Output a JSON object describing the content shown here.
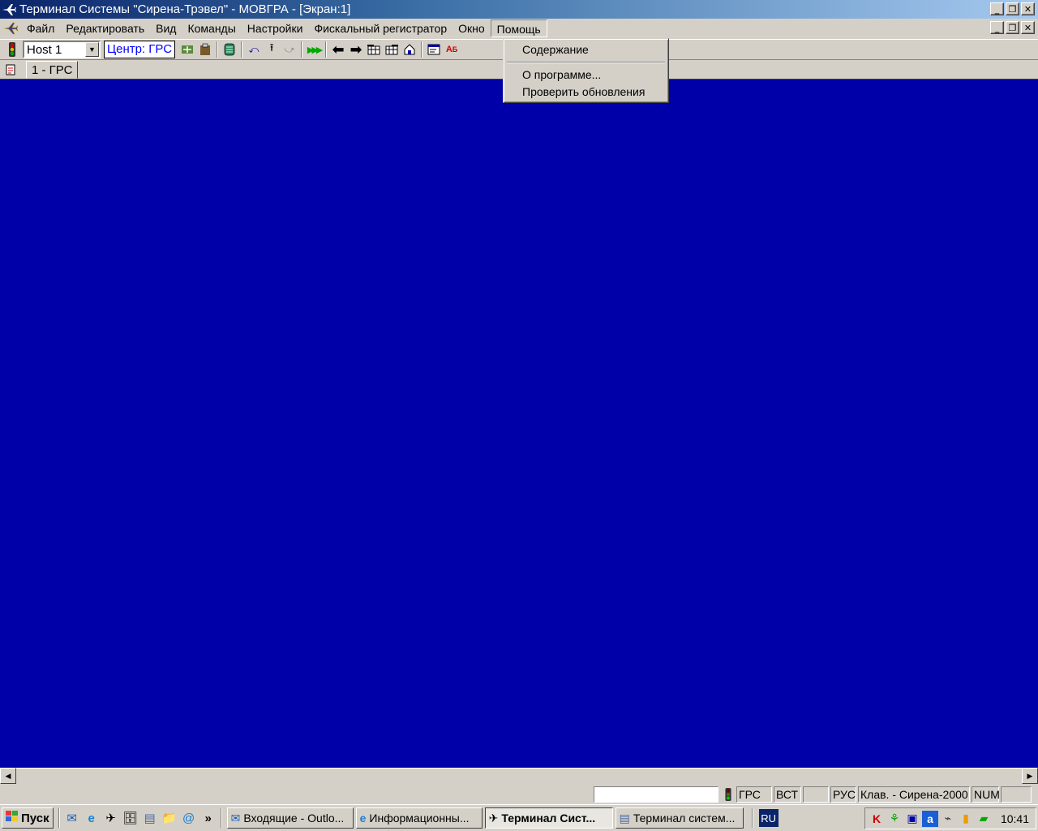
{
  "window": {
    "title": "Терминал Системы \"Сирена-Трэвел\" - МОВГРА - [Экран:1]",
    "app_icon": "airplane-icon"
  },
  "menubar": {
    "items": [
      "Файл",
      "Редактировать",
      "Вид",
      "Команды",
      "Настройки",
      "Фискальный регистратор",
      "Окно",
      "Помощь"
    ],
    "active": "Помощь"
  },
  "help_menu": {
    "items": [
      "Содержание",
      "О программе...",
      "Проверить обновления"
    ]
  },
  "toolbar": {
    "host_select": "Host 1",
    "center_label": "Центр: ГРС"
  },
  "tabs": {
    "screen_tab": "1 - ГРС"
  },
  "terminal": {
    "background": "#0000a8"
  },
  "statusbar": {
    "cells": [
      "ГРС",
      "ВСТ",
      "",
      "РУС",
      "Клав. - Сирена-2000",
      "NUM"
    ]
  },
  "taskbar": {
    "start_label": "Пуск",
    "tasks": [
      "Входящие - Outlo...",
      "Информационны...",
      "Терминал Сист...",
      "Терминал систем..."
    ],
    "active_task": "Терминал Сист...",
    "chevron": "»",
    "lang": "RU",
    "clock": "10:41"
  }
}
